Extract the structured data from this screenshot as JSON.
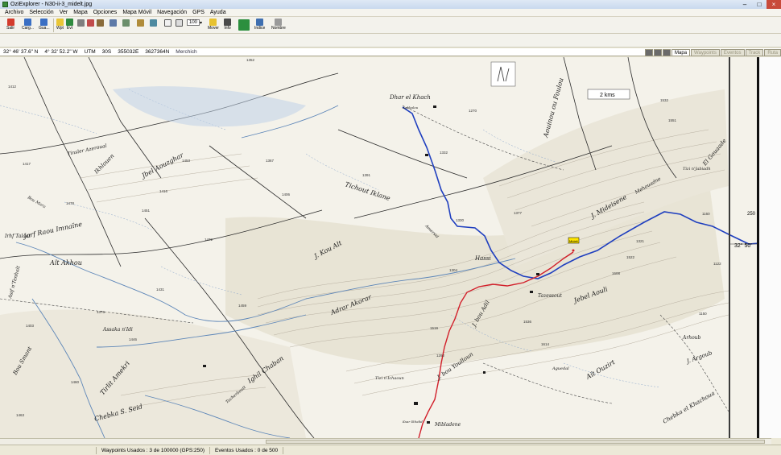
{
  "window": {
    "title": "OziExplorer - N30-ii-3_midelt.jpg"
  },
  "menu": [
    "Archivo",
    "Selección",
    "Ver",
    "Mapa",
    "Opciones",
    "Mapa Móvil",
    "Navegación",
    "GPS",
    "Ayuda"
  ],
  "toolbar": {
    "salir": "Salir",
    "cargar": "Carg...",
    "guardar": "Gua...",
    "wpt": "Wpt",
    "evt": "Evt",
    "mover": "Mover",
    "info": "Info",
    "indice": "Indice",
    "nombre": "Nombre",
    "zoom_value": "100"
  },
  "coords": {
    "lat": "32° 46' 37.6\" N",
    "lon": "4° 32' 52.2\" W",
    "utm_label": "UTM",
    "zone": "30S",
    "easting": "355032E",
    "northing": "3627364N",
    "place": "Merchich"
  },
  "tabs": [
    {
      "label": "Mapa",
      "active": true
    },
    {
      "label": "Waypoints",
      "active": false
    },
    {
      "label": "Eventos",
      "active": false
    },
    {
      "label": "Track",
      "active": false
    },
    {
      "label": "Ruta",
      "active": false
    }
  ],
  "status": {
    "waypoints": "Waypoints Usados : 3 de 100000  (GPS:250)",
    "events": "Eventos Usados : 0 de 500"
  },
  "map": {
    "scale_label": "2 kms",
    "grid_lat_label": "32° 50'",
    "grid_num": "250",
    "waypoint_label": "Midelt",
    "places": [
      "Dhar el Khach",
      "Aghbalou",
      "Jbel Aouzghar",
      "Tichout Iklane",
      "Jorf Raou Imnaïne",
      "Aït Akhou",
      "J. Kou Alt",
      "Adrar Akorar",
      "Hassi",
      "Tazessout",
      "J. Mideisene",
      "Jebel Aouli",
      "Assaka n'Idi",
      "Mibladene",
      "Ksar Ikhalid",
      "J. bou Adil",
      "J. bou Youlloun",
      "Ighil Chaban",
      "Chebka S. Seid",
      "Tirlit Amekri",
      "El Gouaade",
      "Aguedal",
      "Irhf Talaat",
      "Asif n'Tenhalt",
      "Tizi n'Ichaoun",
      "Amersid",
      "Arhoub",
      "Tizi n'Jabiadh",
      "Tinsler Azeroual",
      "Bou Mara",
      "Aouinou ou Foulou",
      "J. Argoub",
      "Mehouadne",
      "Aït Ouzirt",
      "Chebka el Khachoua",
      "Bou Smant",
      "Ikhlouen",
      "Tacherboutt"
    ],
    "spot_heights": [
      "1352",
      "1412",
      "1417",
      "1478",
      "1453",
      "1406",
      "1367",
      "1391",
      "1330",
      "1332",
      "1270",
      "1304",
      "1377",
      "1321",
      "1522",
      "1608",
      "1614",
      "1536",
      "1292",
      "1431",
      "1459",
      "1403",
      "1376",
      "1446",
      "1460",
      "1451",
      "1463",
      "1416",
      "1472",
      "1519",
      "1532",
      "1551",
      "1122",
      "1160",
      "1150"
    ]
  }
}
